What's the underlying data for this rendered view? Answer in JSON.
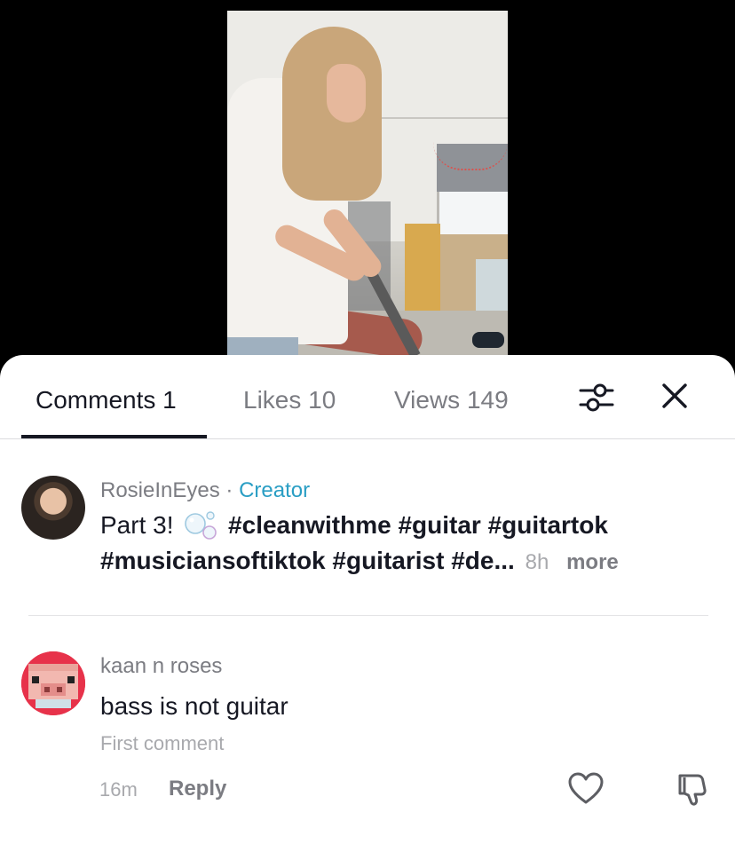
{
  "video": {
    "description_icon": "video-frame"
  },
  "tabs": {
    "comments": "Comments 1",
    "likes": "Likes 10",
    "views": "Views 149",
    "filter_icon": "filter-sliders-icon",
    "close_icon": "close-icon"
  },
  "comments": [
    {
      "username": "RosieInEyes",
      "separator": " · ",
      "badge": "Creator",
      "text_prefix": "Part 3! ",
      "emoji_icon": "bubbles-icon",
      "hashtags_line1": "#cleanwithme #guitar #guitartok",
      "hashtags_line2": "#musiciansoftiktok #guitarist #de...",
      "time": "8h",
      "more": "more"
    },
    {
      "username": "kaan n roses",
      "text": "bass is not guitar",
      "label": "First comment",
      "time": "16m",
      "reply": "Reply",
      "like_icon": "heart-icon",
      "dislike_icon": "thumbs-down-icon"
    }
  ],
  "colors": {
    "creator": "#2a9ec4",
    "text": "#161823",
    "muted": "#7b7c82",
    "light": "#a8a9ad"
  }
}
